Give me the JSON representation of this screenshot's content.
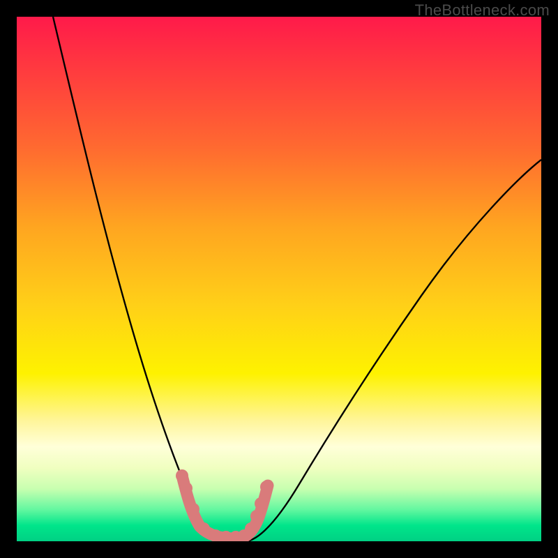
{
  "watermark": {
    "text": "TheBottleneck.com"
  },
  "chart_data": {
    "type": "line",
    "title": "",
    "xlabel": "",
    "ylabel": "",
    "xlim": [
      0,
      100
    ],
    "ylim": [
      0,
      100
    ],
    "grid": false,
    "legend": false,
    "background_gradient": {
      "top": "#ff1a4a",
      "mid": "#fef200",
      "bottom": "#00d184",
      "meaning": "bottleneck severity; red=high, green=none"
    },
    "series": [
      {
        "name": "left-curve",
        "color": "#000000",
        "x": [
          7,
          10,
          14,
          18,
          22,
          25,
          28,
          30,
          33,
          35,
          37
        ],
        "y": [
          100,
          88,
          72,
          56,
          42,
          30,
          20,
          13,
          6,
          2,
          0
        ]
      },
      {
        "name": "right-curve",
        "color": "#000000",
        "x": [
          44,
          47,
          50,
          55,
          60,
          67,
          75,
          85,
          95,
          100
        ],
        "y": [
          0,
          2,
          6,
          12,
          20,
          30,
          42,
          55,
          67,
          73
        ]
      },
      {
        "name": "data-markers",
        "color": "#d97b7b",
        "marker": "round",
        "x": [
          31.5,
          32.3,
          33.5,
          35.5,
          37.5,
          39.5,
          41.5,
          43.0,
          44.5,
          45.5,
          46.3,
          47.5
        ],
        "y": [
          12,
          10,
          6,
          2.5,
          1.5,
          1.0,
          1.0,
          1.2,
          2.5,
          5,
          8,
          11
        ]
      }
    ]
  }
}
